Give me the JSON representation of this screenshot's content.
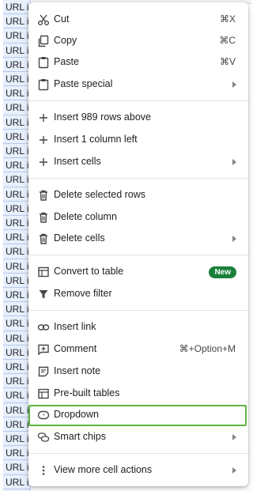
{
  "sheet": {
    "cell_text": "URL i",
    "cell_count": 34
  },
  "menu": {
    "cut": {
      "label": "Cut",
      "shortcut": "⌘X"
    },
    "copy": {
      "label": "Copy",
      "shortcut": "⌘C"
    },
    "paste": {
      "label": "Paste",
      "shortcut": "⌘V"
    },
    "paste_special": {
      "label": "Paste special"
    },
    "insert_rows": {
      "label": "Insert 989 rows above"
    },
    "insert_column": {
      "label": "Insert 1 column left"
    },
    "insert_cells": {
      "label": "Insert cells"
    },
    "delete_rows": {
      "label": "Delete selected rows"
    },
    "delete_column": {
      "label": "Delete column"
    },
    "delete_cells": {
      "label": "Delete cells"
    },
    "convert_table": {
      "label": "Convert to table",
      "badge": "New"
    },
    "remove_filter": {
      "label": "Remove filter"
    },
    "insert_link": {
      "label": "Insert link"
    },
    "comment": {
      "label": "Comment",
      "shortcut": "⌘+Option+M"
    },
    "insert_note": {
      "label": "Insert note"
    },
    "prebuilt_tables": {
      "label": "Pre-built tables"
    },
    "dropdown": {
      "label": "Dropdown"
    },
    "smart_chips": {
      "label": "Smart chips"
    },
    "more_actions": {
      "label": "View more cell actions"
    }
  },
  "colors": {
    "highlight_border": "#5eb440",
    "badge_bg": "#188038",
    "cell_bg": "#e8f0fe"
  }
}
